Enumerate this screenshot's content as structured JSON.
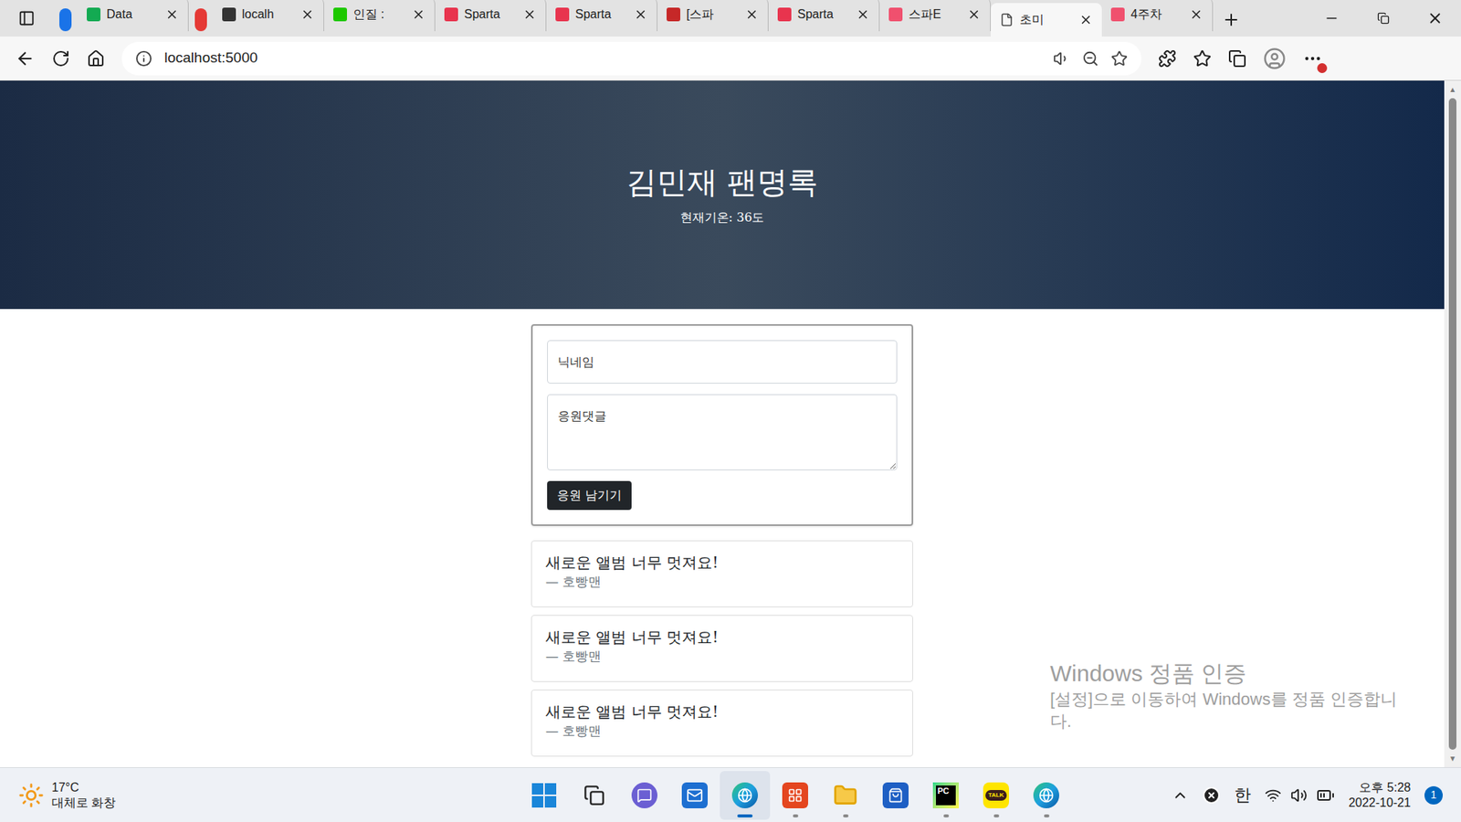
{
  "browser": {
    "tabs": [
      {
        "label": "Data",
        "selected": false,
        "color": "#13aa52",
        "group_color": "#1a73e8"
      },
      {
        "label": "localh",
        "selected": false,
        "color": "#333333",
        "group_color": "#e53935"
      },
      {
        "label": "인질 :",
        "selected": false,
        "color": "#1ec800",
        "group_color": null
      },
      {
        "label": "Sparta",
        "selected": false,
        "color": "#e8344e",
        "group_color": null
      },
      {
        "label": "Sparta",
        "selected": false,
        "color": "#e8344e",
        "group_color": null
      },
      {
        "label": "[스파",
        "selected": false,
        "color": "#c62828",
        "group_color": null
      },
      {
        "label": "Sparta",
        "selected": false,
        "color": "#e8344e",
        "group_color": null
      },
      {
        "label": "스파E",
        "selected": false,
        "color": "#f0506e",
        "group_color": null
      },
      {
        "label": "초미",
        "selected": true,
        "color": "#555555",
        "group_color": null
      },
      {
        "label": "4주차",
        "selected": false,
        "color": "#f0506e",
        "group_color": null
      }
    ],
    "address": "localhost:5000"
  },
  "page": {
    "title": "김민재 팬명록",
    "temperature": "현재기온: 36도",
    "form": {
      "nickname_placeholder": "닉네임",
      "comment_placeholder": "응원댓글",
      "submit": "응원 남기기"
    },
    "comments": [
      {
        "text": "새로운 앨범 너무 멋져요!",
        "author": "— 호빵맨"
      },
      {
        "text": "새로운 앨범 너무 멋져요!",
        "author": "— 호빵맨"
      },
      {
        "text": "새로운 앨범 너무 멋져요!",
        "author": "— 호빵맨"
      }
    ]
  },
  "watermark": {
    "title": "Windows 정품 인증",
    "message": "[설정]으로 이동하여 Windows를 정품 인증합니다."
  },
  "taskbar": {
    "weather": {
      "temp": "17°C",
      "desc": "대체로 화창"
    },
    "apps": [
      {
        "name": "start",
        "glyph": "",
        "running": false,
        "active": false
      },
      {
        "name": "task-view",
        "glyph": "",
        "running": false,
        "active": false
      },
      {
        "name": "chat",
        "glyph": "",
        "running": false,
        "active": false
      },
      {
        "name": "mail",
        "glyph": "",
        "running": false,
        "active": false
      },
      {
        "name": "edge",
        "glyph": "",
        "running": true,
        "active": true
      },
      {
        "name": "office",
        "glyph": "",
        "running": true,
        "active": false
      },
      {
        "name": "explorer",
        "glyph": "",
        "running": true,
        "active": false
      },
      {
        "name": "store",
        "glyph": "",
        "running": false,
        "active": false
      },
      {
        "name": "pycharm",
        "glyph": "PC",
        "running": true,
        "active": false
      },
      {
        "name": "kakaotalk",
        "glyph": "TALK",
        "running": true,
        "active": false
      },
      {
        "name": "edge-dev",
        "glyph": "",
        "running": true,
        "active": false
      }
    ],
    "ime": "한",
    "time": "오후 5:28",
    "date": "2022-10-21",
    "notifications": "1"
  }
}
